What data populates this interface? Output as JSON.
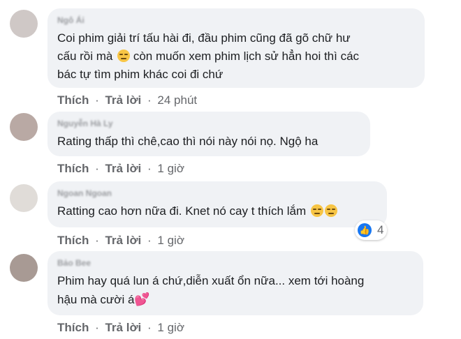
{
  "comments": [
    {
      "author": "Ngô Ái",
      "text": "Coi phim giải trí tấu hài đi, đầu phim cũng đã gõ chữ hư\ncấu rồi mà",
      "text_after_emoji": " còn muốn xem phim lịch sử hẳn hoi thì các\nbác tự tìm phim khác coi đi chứ",
      "like_label": "Thích",
      "reply_label": "Trả lời",
      "time": "24 phút"
    },
    {
      "author": "Nguyễn Hà Ly",
      "text": "Rating thấp thì chê,cao thì nói này nói nọ. Ngộ ha",
      "like_label": "Thích",
      "reply_label": "Trả lời",
      "time": "1 giờ"
    },
    {
      "author": "Ngoan Ngoan",
      "text": "Ratting cao hơn nữa đi. Knet nó cay t thích lắm",
      "like_label": "Thích",
      "reply_label": "Trả lời",
      "time": "1 giờ",
      "reactions": {
        "type": "like",
        "count": "4",
        "color": "#1877f2"
      }
    },
    {
      "author": "Bảo Bee",
      "text": "Phim hay quá lun á chứ,diễn xuất ổn nữa... xem tới hoàng\nhậu mà cười á",
      "like_label": "Thích",
      "reply_label": "Trả lời",
      "time": "1 giờ"
    }
  ],
  "separator": "·",
  "colors": {
    "bubble": "#f0f2f5",
    "meta": "#65676b",
    "text": "#1c1e21"
  }
}
